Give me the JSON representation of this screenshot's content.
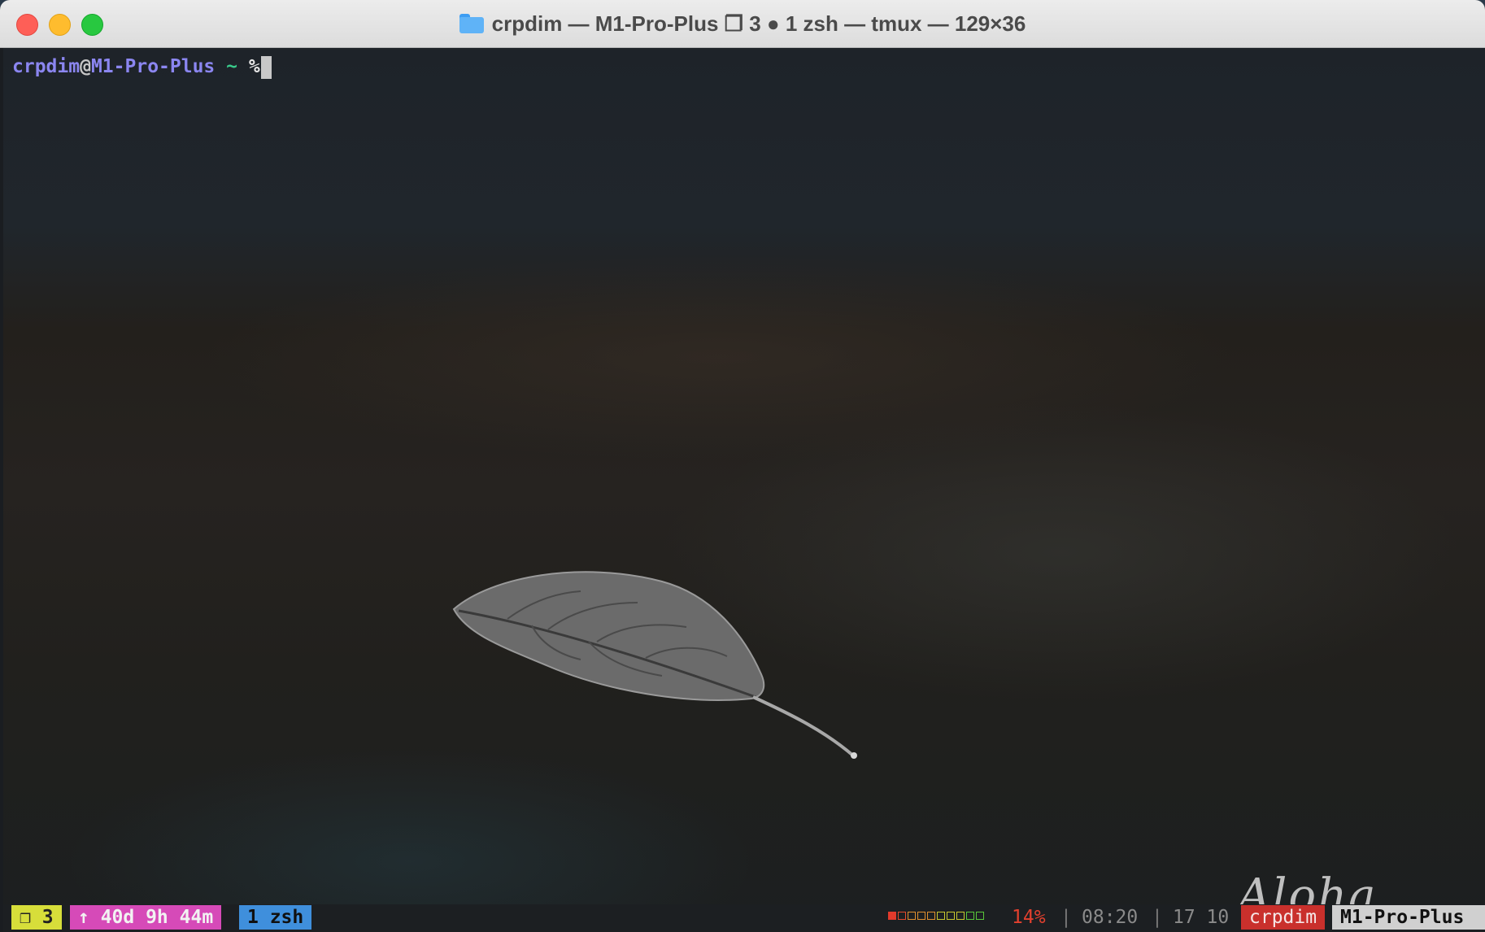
{
  "window": {
    "title": "crpdim — M1-Pro-Plus ❐ 3 ● 1 zsh — tmux — 129×36",
    "title_icon": "folder-icon"
  },
  "prompt": {
    "user": "crpdim",
    "at": "@",
    "host": "M1-Pro-Plus",
    "dir": " ~ ",
    "symbol": "%"
  },
  "wallpaper": {
    "signature": "Aloha"
  },
  "status": {
    "sessions": "❐ 3",
    "uptime": "↑ 40d 9h 44m",
    "window": "1 zsh",
    "battery_percent": "14%",
    "battery_level": 0.14,
    "sep": "|",
    "time": "08:20",
    "date": "17 10",
    "user": "crpdim",
    "host": "M1-Pro-Plus"
  },
  "colors": {
    "session_bg": "#d7de3a",
    "uptime_bg": "#d64ab8",
    "window_bg": "#3f8fdc",
    "user_bg": "#c9302c",
    "host_bg": "#d0d0d0",
    "prompt_user": "#8b86f0",
    "prompt_tilde": "#39c98a"
  }
}
